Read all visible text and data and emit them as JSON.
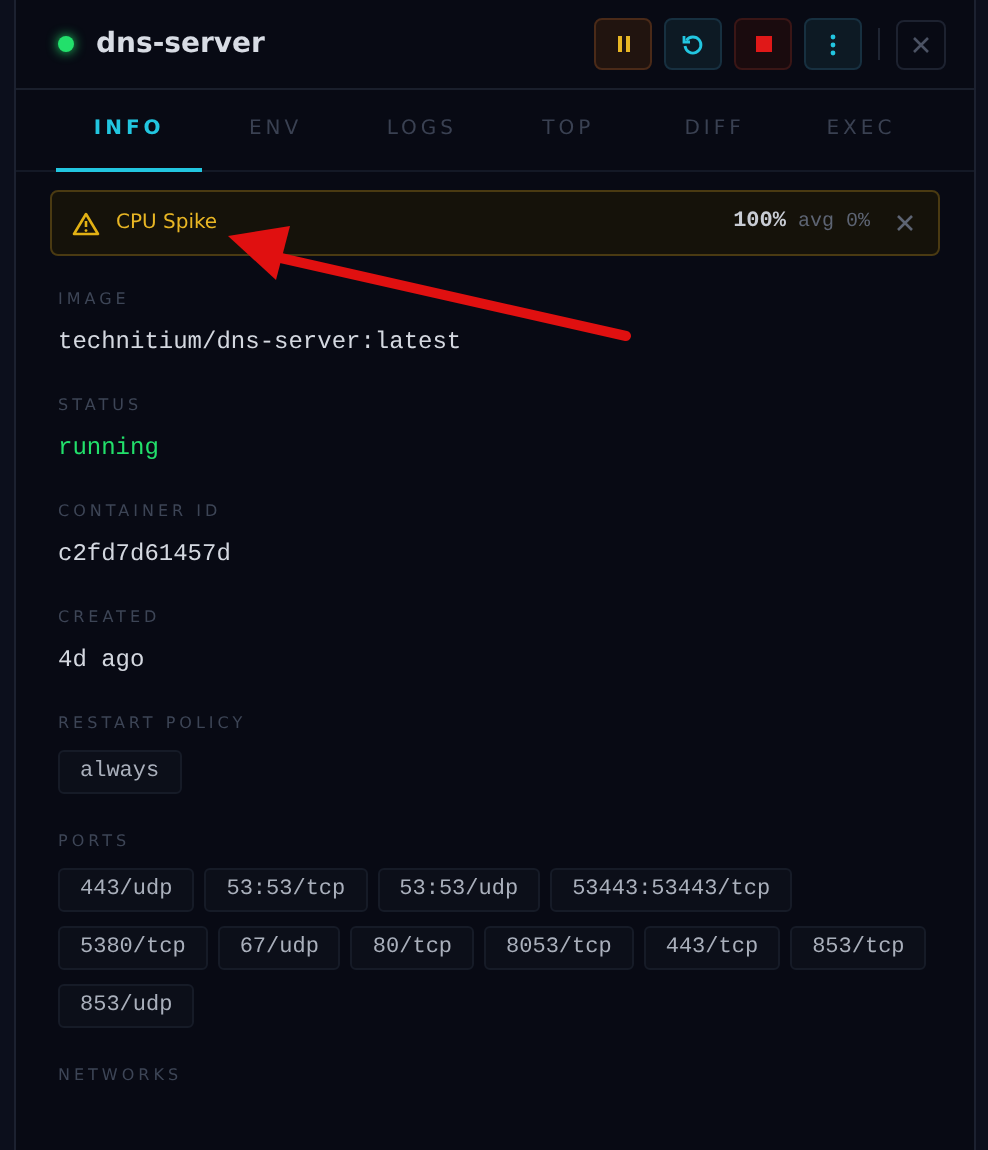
{
  "header": {
    "title": "dns-server",
    "running": true,
    "actions": [
      {
        "kind": "pause"
      },
      {
        "kind": "restart"
      },
      {
        "kind": "stop"
      },
      {
        "kind": "more"
      }
    ],
    "close": {
      "kind": "close"
    }
  },
  "tabs": [
    {
      "label": "INFO",
      "selected": true
    },
    {
      "label": "ENV",
      "selected": false
    },
    {
      "label": "LOGS",
      "selected": false
    },
    {
      "label": "TOP",
      "selected": false
    },
    {
      "label": "DIFF",
      "selected": false
    },
    {
      "label": "EXEC",
      "selected": false
    }
  ],
  "alert": {
    "title": "CPU Spike",
    "reading": "100%",
    "average": "avg 0%"
  },
  "fields": [
    {
      "kind": "text",
      "label": "IMAGE",
      "value": "technitium/dns-server:latest"
    },
    {
      "kind": "status",
      "label": "STATUS",
      "value": "running"
    },
    {
      "kind": "text",
      "label": "CONTAINER ID",
      "value": "c2fd7d61457d"
    },
    {
      "kind": "text",
      "label": "CREATED",
      "value": "4d ago"
    },
    {
      "kind": "chips",
      "label": "RESTART POLICY",
      "values": [
        "always"
      ]
    },
    {
      "kind": "chips",
      "label": "PORTS",
      "values": [
        "443/udp",
        "53:53/tcp",
        "53:53/udp",
        "53443:53443/tcp",
        "5380/tcp",
        "67/udp",
        "80/tcp",
        "8053/tcp",
        "443/tcp",
        "853/tcp",
        "853/udp"
      ]
    },
    {
      "kind": "label",
      "label": "NETWORKS"
    }
  ],
  "annotation": {
    "kind": "arrow"
  }
}
